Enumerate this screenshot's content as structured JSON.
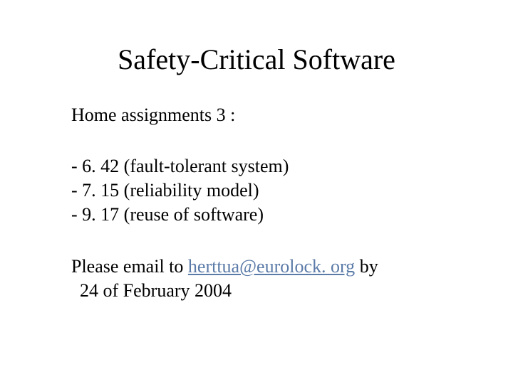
{
  "title": "Safety-Critical Software",
  "subtitle": "Home assignments 3 :",
  "items": [
    "- 6. 42 (fault-tolerant system)",
    "- 7. 15 (reliability model)",
    "- 9. 17 (reuse of software)"
  ],
  "footer": {
    "prefix": "Please email to ",
    "email": "herttua@eurolock. org",
    "suffix": " by",
    "line2": "24 of February 2004"
  }
}
